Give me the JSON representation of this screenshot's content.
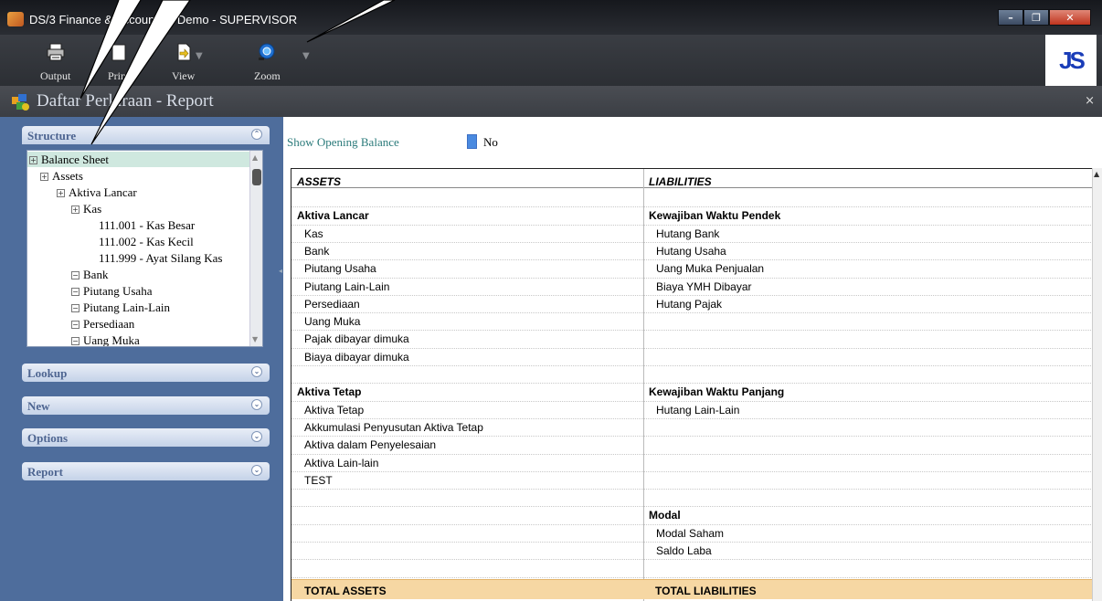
{
  "window": {
    "title": "DS/3 Finance & Accounting Demo - SUPERVISOR",
    "minimize": "–",
    "restore": "❐",
    "close": "✕"
  },
  "toolbar": {
    "output_label": "Output",
    "print_label": "Print",
    "view_label": "View",
    "zoom_label": "Zoom",
    "dropdown_glyph": "▼"
  },
  "report_window": {
    "title": "Daftar Perkiraan - Report",
    "close_glyph": "×"
  },
  "sidebar": {
    "sections": [
      {
        "label": "Structure",
        "state": "expanded",
        "chev": "⌃"
      },
      {
        "label": "Lookup",
        "state": "collapsed",
        "chev": "⌄"
      },
      {
        "label": "New",
        "state": "collapsed",
        "chev": "⌄"
      },
      {
        "label": "Options",
        "state": "collapsed",
        "chev": "⌄"
      },
      {
        "label": "Report",
        "state": "collapsed",
        "chev": "⌄"
      }
    ],
    "tree": [
      {
        "label": "Balance Sheet",
        "toggle": "+",
        "selected": true
      },
      {
        "label": "Assets",
        "toggle": "+"
      },
      {
        "label": "Aktiva Lancar",
        "toggle": "+"
      },
      {
        "label": "Kas",
        "toggle": "+"
      },
      {
        "label": "111.001 - Kas Besar"
      },
      {
        "label": "111.002 - Kas Kecil"
      },
      {
        "label": "111.999 - Ayat Silang Kas"
      },
      {
        "label": "Bank",
        "toggle": "−"
      },
      {
        "label": "Piutang Usaha",
        "toggle": "−"
      },
      {
        "label": "Piutang Lain-Lain",
        "toggle": "−"
      },
      {
        "label": "Persediaan",
        "toggle": "−"
      },
      {
        "label": "Uang Muka",
        "toggle": "−"
      }
    ]
  },
  "main": {
    "opening_balance_label": "Show Opening Balance",
    "opening_balance_value": "No",
    "assets_header": "ASSETS",
    "liabilities_header": "LIABILITIES",
    "assets_rows": [
      {
        "text": "",
        "bold": false
      },
      {
        "text": "Aktiva Lancar",
        "bold": true
      },
      {
        "text": "Kas",
        "bold": false
      },
      {
        "text": "Bank",
        "bold": false
      },
      {
        "text": "Piutang Usaha",
        "bold": false
      },
      {
        "text": "Piutang Lain-Lain",
        "bold": false
      },
      {
        "text": "Persediaan",
        "bold": false
      },
      {
        "text": "Uang Muka",
        "bold": false
      },
      {
        "text": "Pajak dibayar dimuka",
        "bold": false
      },
      {
        "text": "Biaya dibayar dimuka",
        "bold": false
      },
      {
        "text": "",
        "bold": false
      },
      {
        "text": "Aktiva Tetap",
        "bold": true
      },
      {
        "text": "Aktiva Tetap",
        "bold": false
      },
      {
        "text": "Akkumulasi Penyusutan Aktiva Tetap",
        "bold": false
      },
      {
        "text": "Aktiva dalam Penyelesaian",
        "bold": false
      },
      {
        "text": "Aktiva Lain-lain",
        "bold": false
      },
      {
        "text": "TEST",
        "bold": false
      }
    ],
    "liabilities_rows": [
      {
        "text": "",
        "bold": false
      },
      {
        "text": "Kewajiban Waktu Pendek",
        "bold": true
      },
      {
        "text": "Hutang Bank",
        "bold": false
      },
      {
        "text": "Hutang Usaha",
        "bold": false
      },
      {
        "text": "Uang Muka Penjualan",
        "bold": false
      },
      {
        "text": "Biaya YMH Dibayar",
        "bold": false
      },
      {
        "text": "Hutang Pajak",
        "bold": false
      },
      {
        "text": "",
        "bold": false
      },
      {
        "text": "",
        "bold": false
      },
      {
        "text": "",
        "bold": false
      },
      {
        "text": "",
        "bold": false
      },
      {
        "text": "Kewajiban Waktu Panjang",
        "bold": true
      },
      {
        "text": "Hutang Lain-Lain",
        "bold": false
      },
      {
        "text": "",
        "bold": false
      },
      {
        "text": "",
        "bold": false
      },
      {
        "text": "",
        "bold": false
      },
      {
        "text": "",
        "bold": false
      },
      {
        "text": "",
        "bold": false
      },
      {
        "text": "Modal",
        "bold": true
      },
      {
        "text": "Modal Saham",
        "bold": false
      },
      {
        "text": "Saldo Laba",
        "bold": false
      }
    ],
    "total_assets": "TOTAL ASSETS",
    "total_liabilities": "TOTAL LIABILITIES"
  },
  "colors": {
    "panel_bg": "#4e6d9c",
    "total_bg": "#f6d7a3",
    "toggle_fill": "#4a8ae0",
    "selected_row": "#cfe8df"
  }
}
